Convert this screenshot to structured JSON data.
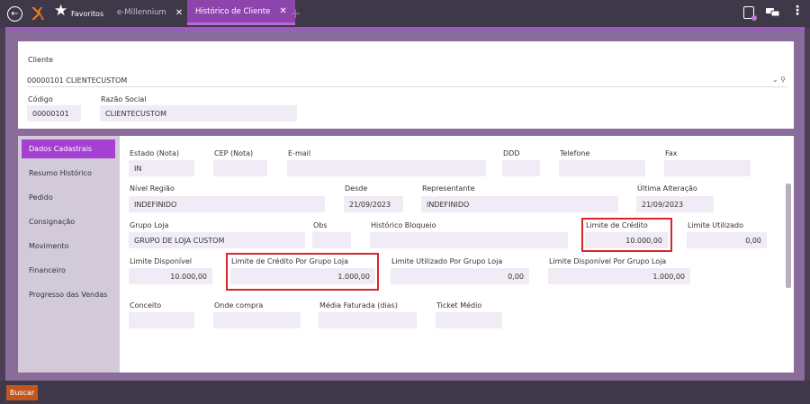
{
  "topbar": {
    "favorites_label": "Favoritos",
    "tabs": [
      {
        "label": "e-Millennium"
      },
      {
        "label": "Histórico de Cliente"
      }
    ],
    "add_tab": "+"
  },
  "header": {
    "cliente_label": "Cliente",
    "cliente_value": "00000101 CLIENTECUSTOM",
    "codigo_label": "Código",
    "codigo_value": "00000101",
    "razao_label": "Razão Social",
    "razao_value": "CLIENTECUSTOM"
  },
  "sidebar": {
    "items": [
      {
        "label": "Dados Cadastrais"
      },
      {
        "label": "Resumo Histórico"
      },
      {
        "label": "Pedido"
      },
      {
        "label": "Consignação"
      },
      {
        "label": "Movimento"
      },
      {
        "label": "Financeiro"
      },
      {
        "label": "Progresso das Vendas"
      }
    ]
  },
  "form": {
    "estado_label": "Estado (Nota)",
    "estado_value": "IN",
    "cep_label": "CEP (Nota)",
    "cep_value": "",
    "email_label": "E-mail",
    "email_value": "",
    "ddd_label": "DDD",
    "ddd_value": "",
    "telefone_label": "Telefone",
    "telefone_value": "",
    "fax_label": "Fax",
    "fax_value": "",
    "nivel_label": "Nível Região",
    "nivel_value": "INDEFINIDO",
    "desde_label": "Desde",
    "desde_value": "21/09/2023",
    "representante_label": "Representante",
    "representante_value": "INDEFINIDO",
    "ultima_label": "Última Alteração",
    "ultima_value": "21/09/2023",
    "grupo_label": "Grupo Loja",
    "grupo_value": "GRUPO DE LOJA CUSTOM",
    "obs_label": "Obs",
    "obs_value": "",
    "historico_label": "Histórico Bloqueio",
    "historico_value": "",
    "limite_credito_label": "Limite de Crédito",
    "limite_credito_value": "10.000,00",
    "limite_utilizado_label": "Limite Utilizado",
    "limite_utilizado_value": "0,00",
    "limite_disponivel_label": "Limite Disponível",
    "limite_disponivel_value": "10.000,00",
    "lc_grupo_label": "Limite de Crédito Por Grupo Loja",
    "lc_grupo_value": "1.000,00",
    "lu_grupo_label": "Limite Utilizado Por Grupo Loja",
    "lu_grupo_value": "0,00",
    "ld_grupo_label": "Limite Disponível Por Grupo Loja",
    "ld_grupo_value": "1.000,00",
    "conceito_label": "Conceito",
    "conceito_value": "",
    "onde_label": "Onde compra",
    "onde_value": "",
    "media_label": "Média Faturada (dias)",
    "media_value": "",
    "ticket_label": "Ticket Médio",
    "ticket_value": ""
  },
  "footer": {
    "buscar_label": "Buscar"
  },
  "colors": {
    "accent": "#8e44ad",
    "menu_active": "#a640d3",
    "highlight": "#d9262b",
    "buscar": "#c1561e"
  }
}
